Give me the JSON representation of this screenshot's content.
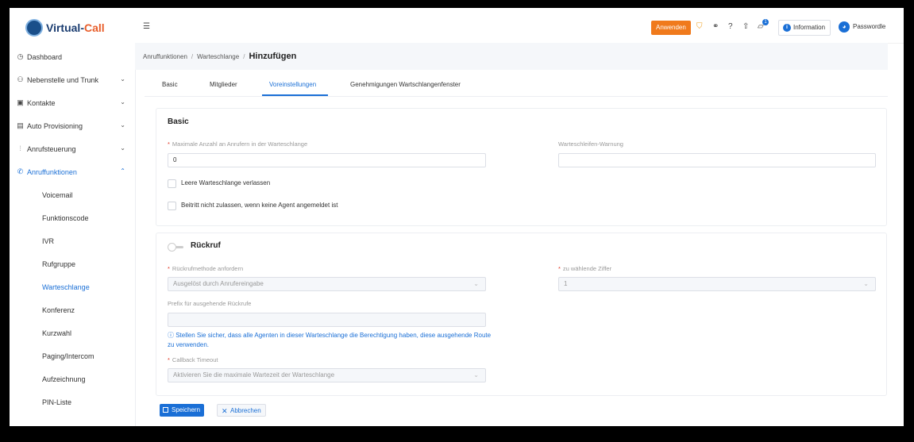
{
  "app": {
    "logo_text_a": "Virtual-",
    "logo_text_b": "Call"
  },
  "sidebar": {
    "items": [
      {
        "label": "Dashboard",
        "icon": "dashboard-icon",
        "glyph": "◷"
      },
      {
        "label": "Nebenstelle und Trunk",
        "icon": "extension-icon",
        "glyph": "⚇",
        "chevron": "⌄"
      },
      {
        "label": "Kontakte",
        "icon": "contacts-icon",
        "glyph": "▣",
        "chevron": "⌄"
      },
      {
        "label": "Auto Provisioning",
        "icon": "provisioning-icon",
        "glyph": "▤",
        "chevron": "⌄"
      },
      {
        "label": "Anrufsteuerung",
        "icon": "call-control-icon",
        "glyph": "⫶",
        "chevron": "⌄"
      },
      {
        "label": "Anruffunktionen",
        "icon": "phone-icon",
        "glyph": "✆",
        "chevron": "⌃"
      }
    ],
    "subitems": [
      "Voicemail",
      "Funktionscode",
      "IVR",
      "Rufgruppe",
      "Warteschlange",
      "Konferenz",
      "Kurzwahl",
      "Paging/Intercom",
      "Aufzeichnung",
      "PIN-Liste"
    ]
  },
  "topbar": {
    "apply_label": "Anwenden",
    "info_label": "Information",
    "user_label": "Passwordle",
    "badge": "1"
  },
  "breadcrumb": {
    "a": "Anruffunktionen",
    "b": "Warteschlange",
    "current": "Hinzufügen"
  },
  "tabs": [
    "Basic",
    "Mitglieder",
    "Voreinstellungen",
    "Genehmigungen Wartschlangenfenster"
  ],
  "basic": {
    "title": "Basic",
    "max_callers_label": "Maximale Anzahl an Anrufern in der Warteschlange",
    "max_callers_value": "0",
    "warning_label": "Warteschleifen-Warnung",
    "warning_value": "",
    "check1": "Leere Warteschlange verlassen",
    "check2": "Beitritt nicht zulassen, wenn keine Agent angemeldet ist"
  },
  "callback": {
    "title": "Rückruf",
    "method_label": "Rückrufmethode anfordern",
    "method_value": "Ausgelöst durch Anrufereingabe",
    "digit_label": "zu wählende Ziffer",
    "digit_value": "1",
    "prefix_label": "Prefix für ausgehende Rückrufe",
    "prefix_value": "",
    "hint": "ⓘ Stellen Sie sicher, dass alle Agenten in dieser Warteschlange die Berechtigung haben, diese ausgehende Route zu verwenden.",
    "timeout_label": "Callback Timeout",
    "timeout_value": "Aktivieren Sie die maximale Wartezeit der Warteschlange"
  },
  "footer": {
    "save_label": "Speichern",
    "cancel_label": "Abbrechen"
  },
  "colors": {
    "accent": "#1a6fd6",
    "apply": "#f07a1c"
  }
}
